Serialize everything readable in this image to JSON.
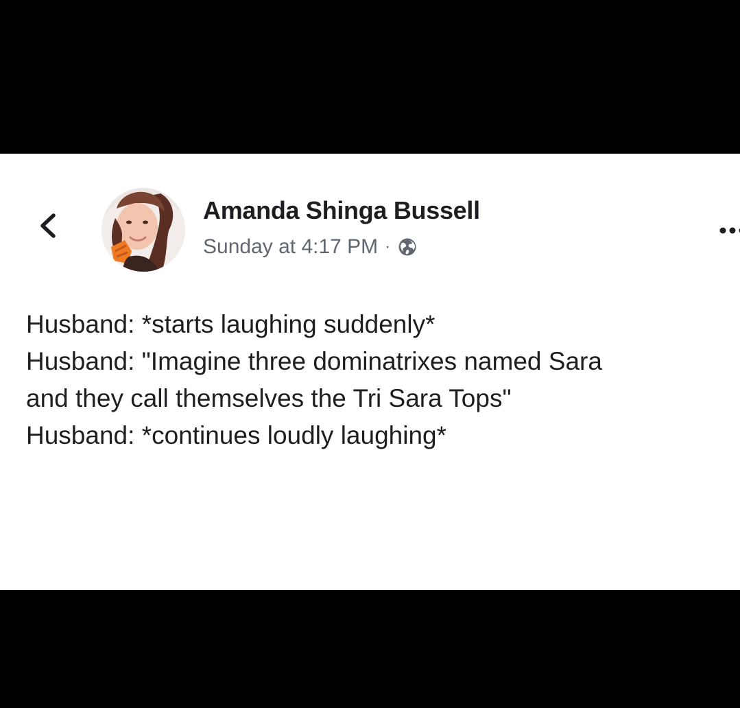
{
  "post": {
    "author_name": "Amanda Shinga Bussell",
    "timestamp": "Sunday at 4:17 PM",
    "separator": "·",
    "audience_icon": "globe-icon",
    "back_icon": "chevron-left-icon",
    "more_icon": "more-dots-icon",
    "lines": [
      "Husband: *starts laughing suddenly*",
      "Husband: \"Imagine three dominatrixes named Sara",
      "and they call themselves the Tri Sara Tops\"",
      "Husband: *continues loudly laughing*"
    ]
  },
  "colors": {
    "letterbox": "#000000",
    "card_background": "#ffffff",
    "name_text": "#1c1e21",
    "meta_text": "#606770",
    "body_text": "#1c1e21"
  }
}
